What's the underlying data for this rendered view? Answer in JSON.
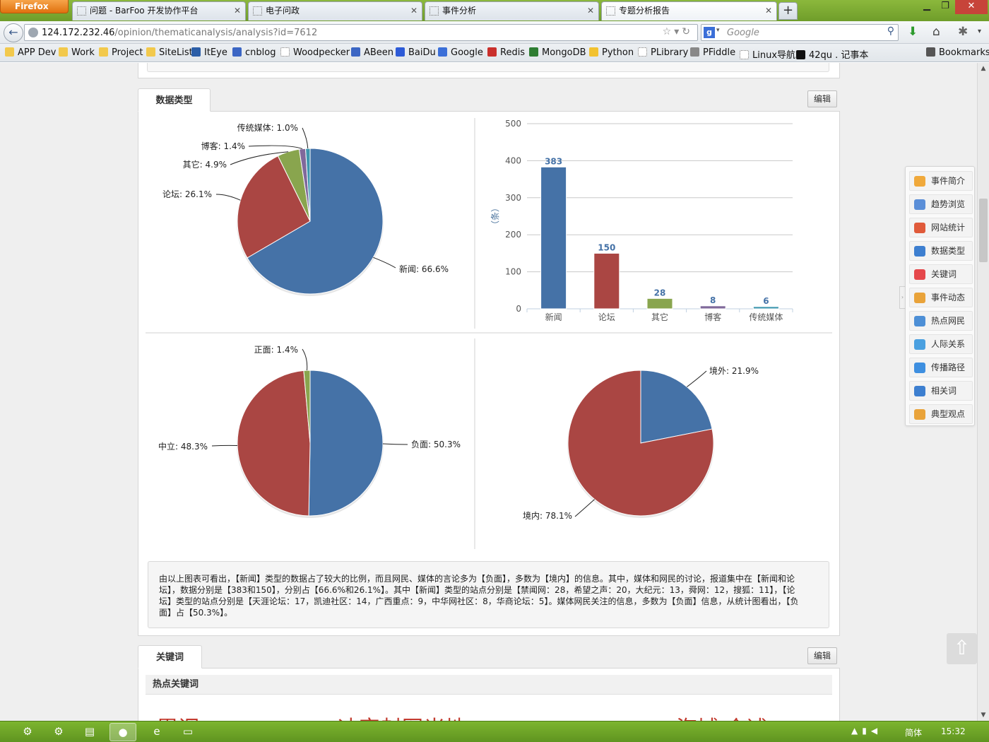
{
  "browser": {
    "app_button": "Firefox",
    "tabs": [
      {
        "title": "问题 - BarFoo 开发协作平台"
      },
      {
        "title": "电子问政"
      },
      {
        "title": "事件分析"
      },
      {
        "title": "专题分析报告",
        "active": true
      }
    ],
    "url_host": "124.172.232.46",
    "url_path": "/opinion/thematicanalysis/analysis?id=7612",
    "search_engine_letter": "g",
    "search_placeholder": "Google",
    "bookmarks": [
      {
        "label": "APP Dev",
        "icon": "folder-icon"
      },
      {
        "label": "Work",
        "icon": "folder-icon"
      },
      {
        "label": "Project",
        "icon": "folder-icon"
      },
      {
        "label": "SiteList",
        "icon": "folder-icon"
      },
      {
        "label": "ItEye",
        "icon": "iteye-icon"
      },
      {
        "label": "cnblog",
        "icon": "cnblog-icon"
      },
      {
        "label": "Woodpecker",
        "icon": "page-icon"
      },
      {
        "label": "ABeen",
        "icon": "abeen-icon"
      },
      {
        "label": "BaiDu",
        "icon": "baidu-icon"
      },
      {
        "label": "Google",
        "icon": "google-icon"
      },
      {
        "label": "Redis",
        "icon": "redis-icon"
      },
      {
        "label": "MongoDB",
        "icon": "mongodb-icon"
      },
      {
        "label": "Python",
        "icon": "python-icon"
      },
      {
        "label": "PLibrary",
        "icon": "page-icon"
      },
      {
        "label": "PFiddle",
        "icon": "pfiddle-icon"
      },
      {
        "label": "Linux导航",
        "icon": "page-icon"
      },
      {
        "label": "42qu . 记事本",
        "icon": "42qu-icon"
      }
    ],
    "bookmarks_menu": "Bookmarks"
  },
  "panel_datatype": {
    "tab_label": "数据类型",
    "edit_label": "编辑"
  },
  "panel_keywords": {
    "tab_label": "关键词",
    "edit_label": "编辑",
    "section_title": "热点关键词",
    "cloud_words": [
      "胃调",
      "冲突",
      "封图",
      "米地",
      "海域",
      "介述"
    ]
  },
  "summary_text": "由以上图表可看出，【新闻】类型的数据占了较大的比例，而且网民、媒体的言论多为【负面】，多数为【境内】的信息。其中，媒体和网民的讨论，报道集中在【新闻和论坛】，数据分别是【383和150】，分别占【66.6%和26.1%】。其中【新闻】类型的站点分别是【禁闻网：28，希望之声：20，大纪元：13，舜网：12，搜狐：11】，【论坛】类型的站点分别是【天涯论坛：17，凯迪社区：14，广西重点：9，中华网社区：8，华商论坛：5】。媒体网民关注的信息，多数为【负面】信息，从统计图看出，【负面】占【50.3%】。",
  "side_menu": [
    {
      "label": "事件简介",
      "icon": "book-icon",
      "color": "#f0a93b"
    },
    {
      "label": "趋势浏览",
      "icon": "trend-icon",
      "color": "#5b8fd8"
    },
    {
      "label": "网站统计",
      "icon": "bar-chart-icon",
      "color": "#e05a3a"
    },
    {
      "label": "数据类型",
      "icon": "database-icon",
      "color": "#3d7fd0"
    },
    {
      "label": "关键词",
      "icon": "keyword-icon",
      "color": "#e5474b"
    },
    {
      "label": "事件动态",
      "icon": "timeline-icon",
      "color": "#e9a33a"
    },
    {
      "label": "热点网民",
      "icon": "user-icon",
      "color": "#4d8fd6"
    },
    {
      "label": "人际关系",
      "icon": "network-icon",
      "color": "#4aa0e0"
    },
    {
      "label": "传播路径",
      "icon": "globe-icon",
      "color": "#3e8fe0"
    },
    {
      "label": "相关词",
      "icon": "signal-icon",
      "color": "#3d7fd0"
    },
    {
      "label": "典型观点",
      "icon": "thumbs-up-icon",
      "color": "#e9a33a"
    }
  ],
  "colors": {
    "blue": "#4572a7",
    "red": "#aa4643",
    "green": "#89a54e",
    "purple": "#80699b",
    "teal": "#3d96ae",
    "panel_border": "#d6d6d6"
  },
  "taskbar": {
    "lang": "简体",
    "time": "15:32"
  },
  "chart_data": [
    {
      "type": "pie",
      "slices": [
        {
          "name": "新闻",
          "value": 66.6,
          "label": "新闻: 66.6%",
          "color": "#4572a7"
        },
        {
          "name": "论坛",
          "value": 26.1,
          "label": "论坛: 26.1%",
          "color": "#aa4643"
        },
        {
          "name": "其它",
          "value": 4.9,
          "label": "其它: 4.9%",
          "color": "#89a54e"
        },
        {
          "name": "博客",
          "value": 1.4,
          "label": "博客: 1.4%",
          "color": "#80699b"
        },
        {
          "name": "传统媒体",
          "value": 1.0,
          "label": "传统媒体: 1.0%",
          "color": "#3d96ae"
        }
      ]
    },
    {
      "type": "bar",
      "categories": [
        "新闻",
        "论坛",
        "其它",
        "博客",
        "传统媒体"
      ],
      "values": [
        383,
        150,
        28,
        8,
        6
      ],
      "data_labels": [
        "383",
        "150",
        "28",
        "8",
        "6"
      ],
      "colors": [
        "#4572a7",
        "#aa4643",
        "#89a54e",
        "#80699b",
        "#3d96ae"
      ],
      "ylabel": "（条）",
      "ylim": [
        0,
        500
      ],
      "yticks": [
        "0",
        "100",
        "200",
        "300",
        "400",
        "500"
      ],
      "grid": true
    },
    {
      "type": "pie",
      "slices": [
        {
          "name": "负面",
          "value": 50.3,
          "label": "负面: 50.3%",
          "color": "#4572a7"
        },
        {
          "name": "中立",
          "value": 48.3,
          "label": "中立: 48.3%",
          "color": "#aa4643"
        },
        {
          "name": "正面",
          "value": 1.4,
          "label": "正面: 1.4%",
          "color": "#89a54e"
        }
      ]
    },
    {
      "type": "pie",
      "slices": [
        {
          "name": "境外",
          "value": 21.9,
          "label": "境外: 21.9%",
          "color": "#4572a7"
        },
        {
          "name": "境内",
          "value": 78.1,
          "label": "境内: 78.1%",
          "color": "#aa4643"
        }
      ]
    }
  ]
}
